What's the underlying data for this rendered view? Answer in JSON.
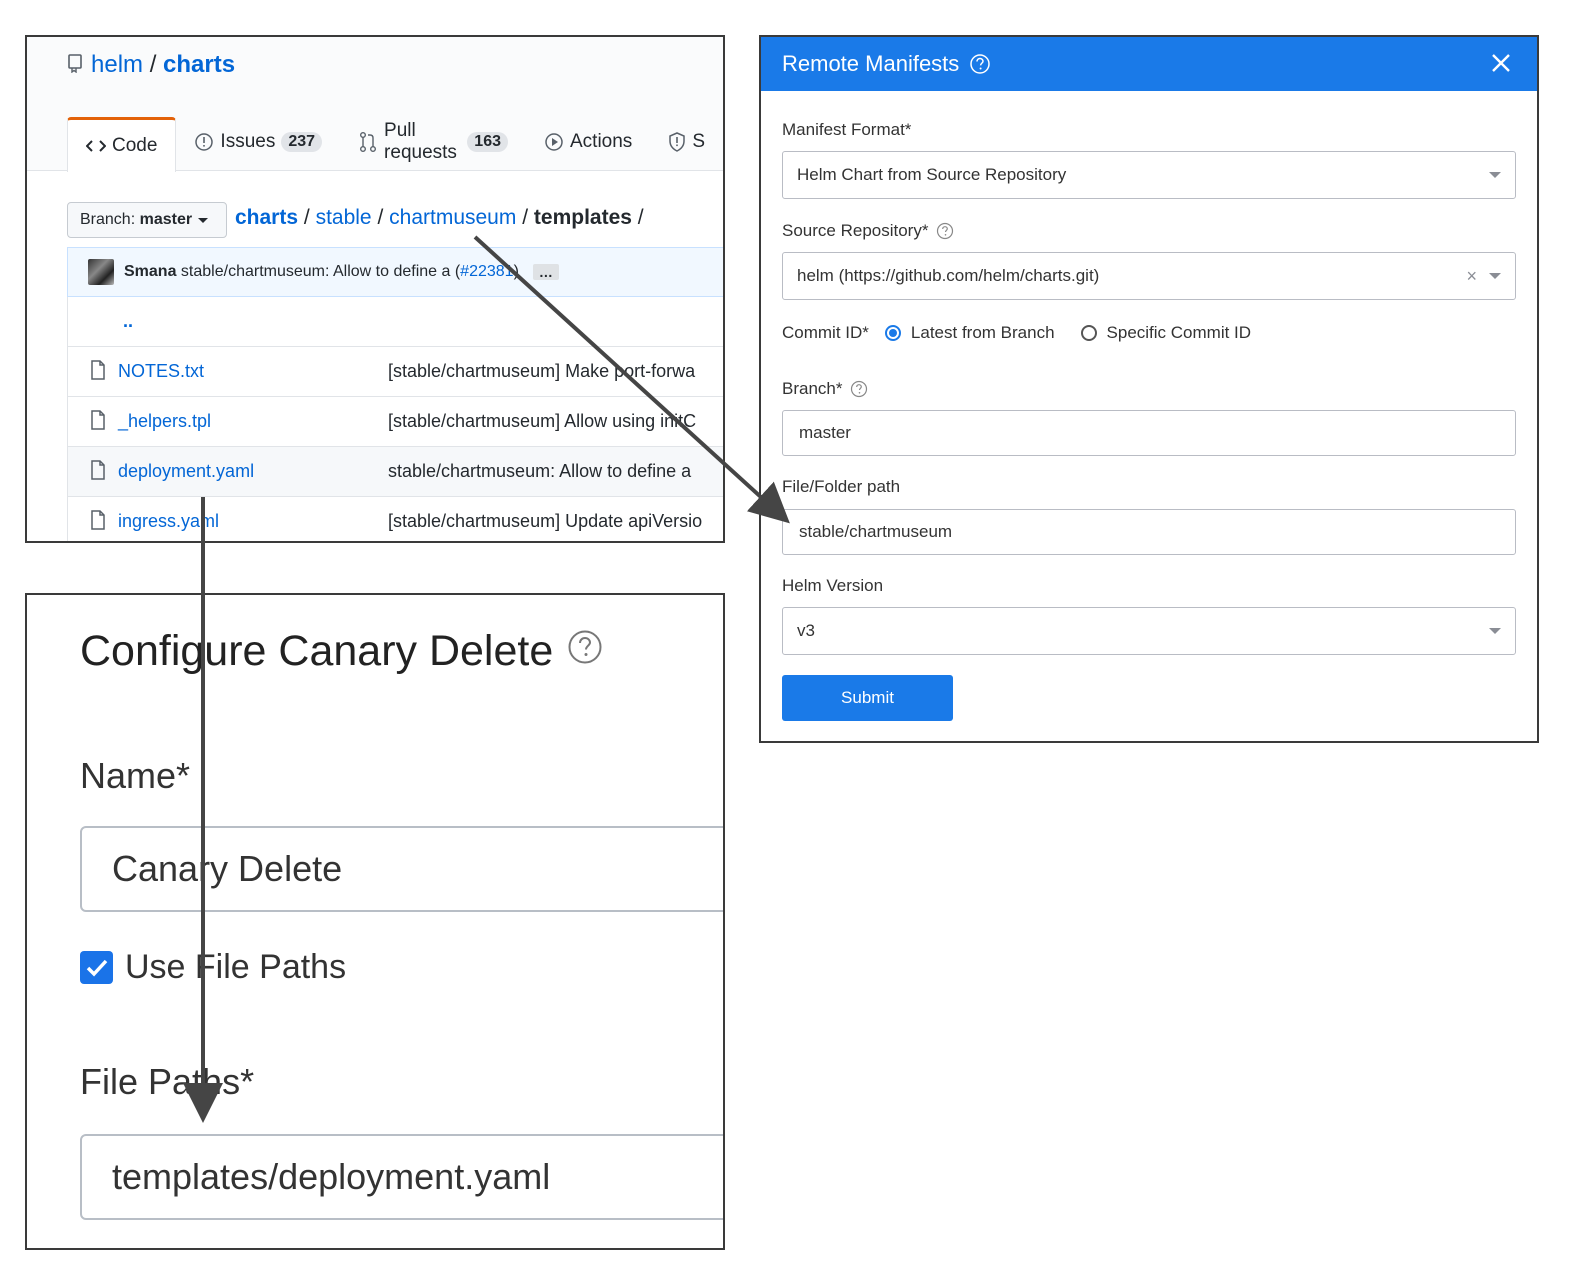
{
  "github": {
    "owner": "helm",
    "separator": "/",
    "repo": "charts",
    "tabs": [
      {
        "label": "Code",
        "count": ""
      },
      {
        "label": "Issues",
        "count": "237"
      },
      {
        "label": "Pull requests",
        "count": "163"
      },
      {
        "label": "Actions",
        "count": ""
      },
      {
        "label": "S",
        "count": ""
      }
    ],
    "branch_prefix": "Branch:",
    "branch": "master",
    "breadcrumb": [
      "charts",
      "stable",
      "chartmuseum",
      "templates"
    ],
    "commit": {
      "author": "Smana",
      "message": "stable/chartmuseum: Allow to define a (",
      "pr": "#22381",
      "close": ")",
      "more": "…"
    },
    "parent_dir": "..",
    "files": [
      {
        "name": "NOTES.txt",
        "message": "[stable/chartmuseum] Make port-forwa"
      },
      {
        "name": "_helpers.tpl",
        "message": "[stable/chartmuseum] Allow using initC"
      },
      {
        "name": "deployment.yaml",
        "message": "stable/chartmuseum: Allow to define a"
      },
      {
        "name": "ingress.yaml",
        "message": "[stable/chartmuseum] Update apiVersio"
      }
    ]
  },
  "canary": {
    "title": "Configure Canary Delete",
    "name_label": "Name*",
    "name_value": "Canary Delete",
    "use_file_paths": "Use File Paths",
    "use_file_paths_checked": true,
    "file_paths_label": "File Paths*",
    "file_paths_value": "templates/deployment.yaml"
  },
  "remote_manifests": {
    "title": "Remote Manifests",
    "manifest_format_label": "Manifest Format*",
    "manifest_format_value": "Helm Chart from Source Repository",
    "source_repo_label": "Source Repository*",
    "source_repo_value": "helm (https://github.com/helm/charts.git)",
    "commit_id_label": "Commit ID*",
    "commit_options": [
      "Latest from Branch",
      "Specific Commit ID"
    ],
    "commit_selected": "Latest from Branch",
    "branch_label": "Branch*",
    "branch_value": "master",
    "path_label": "File/Folder path",
    "path_value": "stable/chartmuseum",
    "helm_version_label": "Helm Version",
    "helm_version_value": "v3",
    "submit_label": "Submit",
    "accent": "#1a7ae8"
  }
}
